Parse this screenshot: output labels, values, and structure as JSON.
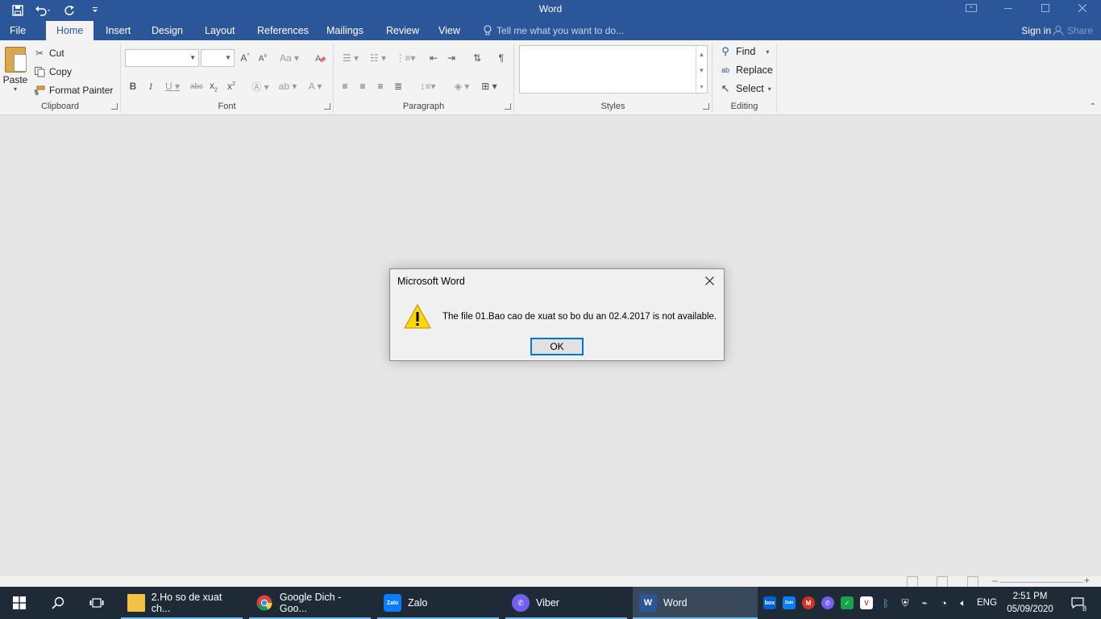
{
  "window": {
    "title": "Word"
  },
  "tabs": {
    "file": "File",
    "home": "Home",
    "insert": "Insert",
    "design": "Design",
    "layout": "Layout",
    "references": "References",
    "mailings": "Mailings",
    "review": "Review",
    "view": "View",
    "tell_me": "Tell me what you want to do...",
    "sign_in": "Sign in",
    "share": "Share"
  },
  "ribbon": {
    "clipboard": {
      "paste": "Paste",
      "cut": "Cut",
      "copy": "Copy",
      "format_painter": "Format Painter",
      "label": "Clipboard"
    },
    "font": {
      "label": "Font",
      "font_name_value": "",
      "font_size_value": ""
    },
    "paragraph": {
      "label": "Paragraph"
    },
    "styles": {
      "label": "Styles"
    },
    "editing": {
      "find": "Find",
      "replace": "Replace",
      "select": "Select",
      "label": "Editing"
    }
  },
  "dialog": {
    "title": "Microsoft Word",
    "message": "The file 01.Bao cao de xuat so bo du an 02.4.2017 is not available.",
    "ok": "OK",
    "icon": "warning-icon"
  },
  "taskbar": {
    "apps": [
      {
        "label": "2.Ho so de xuat ch...",
        "icon": "folder-icon"
      },
      {
        "label": "Google Dich - Goo...",
        "icon": "chrome-icon"
      },
      {
        "label": "Zalo",
        "icon": "zalo-icon"
      },
      {
        "label": "Viber",
        "icon": "viber-icon"
      },
      {
        "label": "Word",
        "icon": "word-icon"
      }
    ],
    "tray_badges": {
      "box": "box",
      "zalo": "Zalo"
    },
    "language": "ENG",
    "time": "2:51 PM",
    "date": "05/09/2020",
    "notification_count": "8"
  },
  "colors": {
    "word_blue": "#2b579a",
    "taskbar": "#1f2a37",
    "focus_blue": "#0078d7",
    "warning_yellow": "#ffd800"
  }
}
